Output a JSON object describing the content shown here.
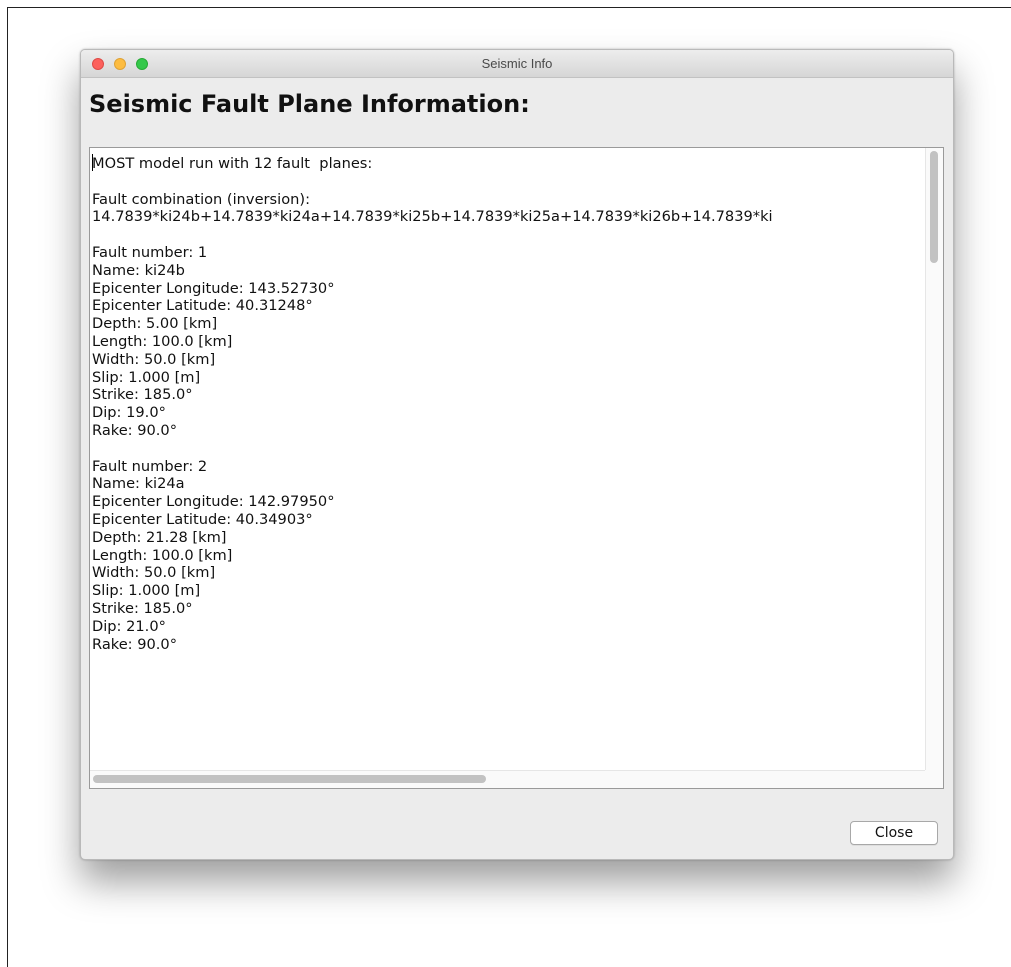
{
  "window": {
    "title": "Seismic Info"
  },
  "heading": "Seismic Fault Plane Information:",
  "content": {
    "lines": [
      "MOST model run with 12 fault  planes:",
      "",
      "Fault combination (inversion):",
      "14.7839*ki24b+14.7839*ki24a+14.7839*ki25b+14.7839*ki25a+14.7839*ki26b+14.7839*ki",
      "",
      "Fault number: 1",
      "Name: ki24b",
      "Epicenter Longitude: 143.52730°",
      "Epicenter Latitude: 40.31248°",
      "Depth: 5.00 [km]",
      "Length: 100.0 [km]",
      "Width: 50.0 [km]",
      "Slip: 1.000 [m]",
      "Strike: 185.0°",
      "Dip: 19.0°",
      "Rake: 90.0°",
      "",
      "Fault number: 2",
      "Name: ki24a",
      "Epicenter Longitude: 142.97950°",
      "Epicenter Latitude: 40.34903°",
      "Depth: 21.28 [km]",
      "Length: 100.0 [km]",
      "Width: 50.0 [km]",
      "Slip: 1.000 [m]",
      "Strike: 185.0°",
      "Dip: 21.0°",
      "Rake: 90.0°"
    ]
  },
  "buttons": {
    "close_label": "Close"
  },
  "colors": {
    "traffic_close": "#fc605c",
    "traffic_minimize": "#fdbc40",
    "traffic_maximize": "#34c84a"
  }
}
